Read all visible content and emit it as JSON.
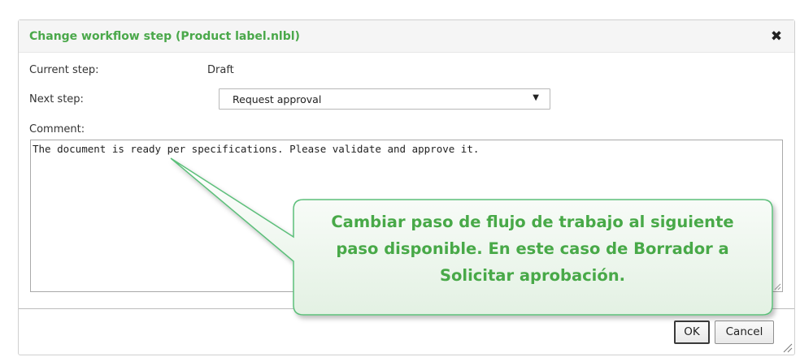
{
  "dialog": {
    "title": "Change workflow step (Product label.nlbl)",
    "close_icon": "close-x-icon",
    "current_step_label": "Current step:",
    "current_step_value": "Draft",
    "next_step_label": "Next step:",
    "next_step_selected": "Request approval",
    "comment_label": "Comment:",
    "comment_value": "The document is ready per specifications. Please validate and approve it.",
    "ok_label": "OK",
    "cancel_label": "Cancel"
  },
  "callout": {
    "line1": "Cambiar paso de flujo de trabajo al siguiente",
    "line2": "paso disponible. En este caso de Borrador a",
    "line3": "Solicitar aprobación.",
    "accent_color": "#48a948"
  },
  "colors": {
    "title": "#4aa84a",
    "callout_border": "#5cbf7a"
  }
}
